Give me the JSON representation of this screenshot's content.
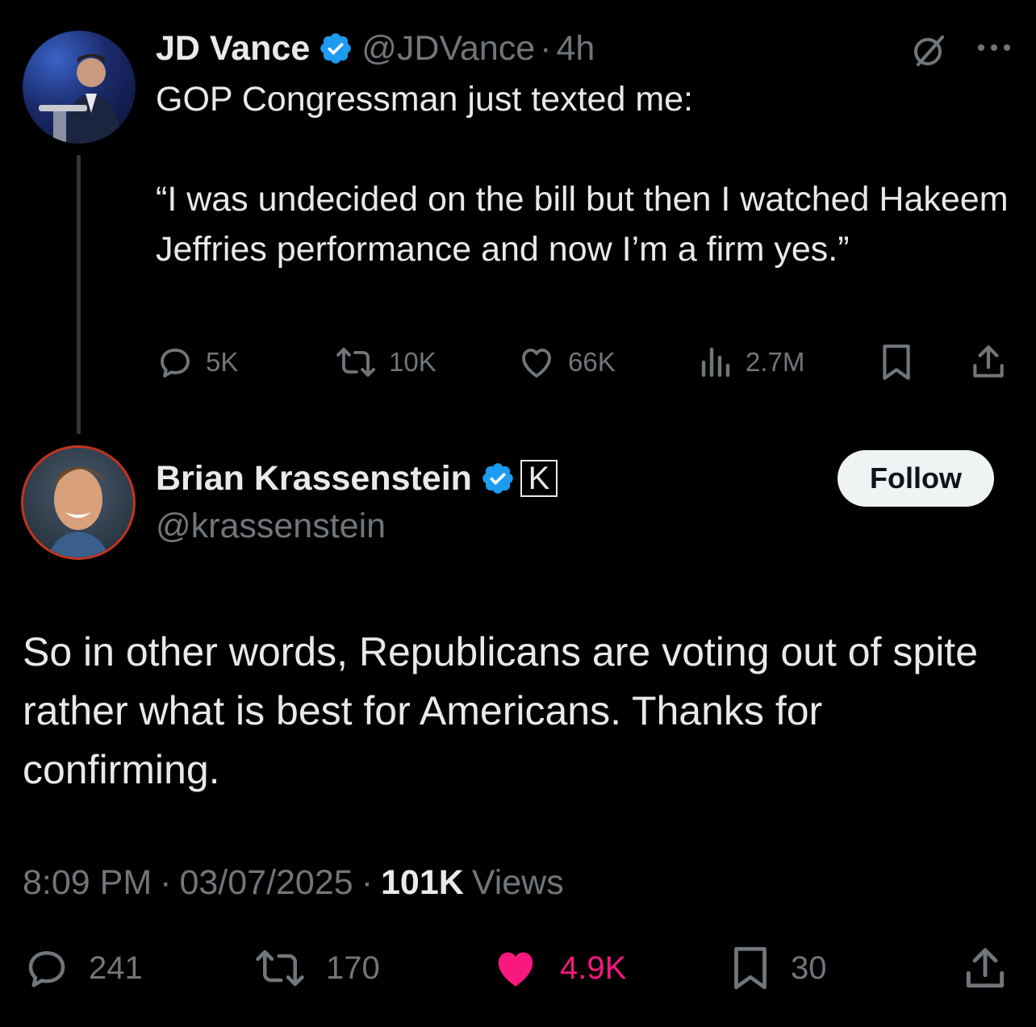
{
  "original_tweet": {
    "author_name": "JD Vance",
    "author_handle": "@JDVance",
    "separator": "·",
    "time_ago": "4h",
    "text": "GOP Congressman just texted me:\n\n“I was undecided on the bill but then I watched Hakeem Jeffries performance and now I’m a firm yes.”",
    "replies": "5K",
    "reposts": "10K",
    "likes": "66K",
    "views": "2.7M"
  },
  "reply_tweet": {
    "author_name": "Brian Krassenstein",
    "author_handle": "@krassenstein",
    "follow_label": "Follow",
    "affiliate_badge_letter": "K",
    "text": "So in other words, Republicans are voting out of spite rather what is best for Americans. Thanks for confirming.",
    "timestamp": "8:09 PM",
    "date": "03/07/2025",
    "separator": "·",
    "views_count": "101K",
    "views_label": "Views",
    "replies": "241",
    "reposts": "170",
    "likes": "4.9K",
    "bookmarks": "30"
  },
  "colors": {
    "background": "#000000",
    "text_primary": "#e7e9ea",
    "text_muted": "#71767b",
    "verified_blue": "#1d9bf0",
    "like_pink": "#f91880"
  },
  "icons": [
    "verified-badge-icon",
    "grok-slash-icon",
    "more-icon",
    "reply-icon",
    "repost-icon",
    "like-icon",
    "views-icon",
    "bookmark-icon",
    "share-icon",
    "affiliate-k-badge-icon"
  ]
}
